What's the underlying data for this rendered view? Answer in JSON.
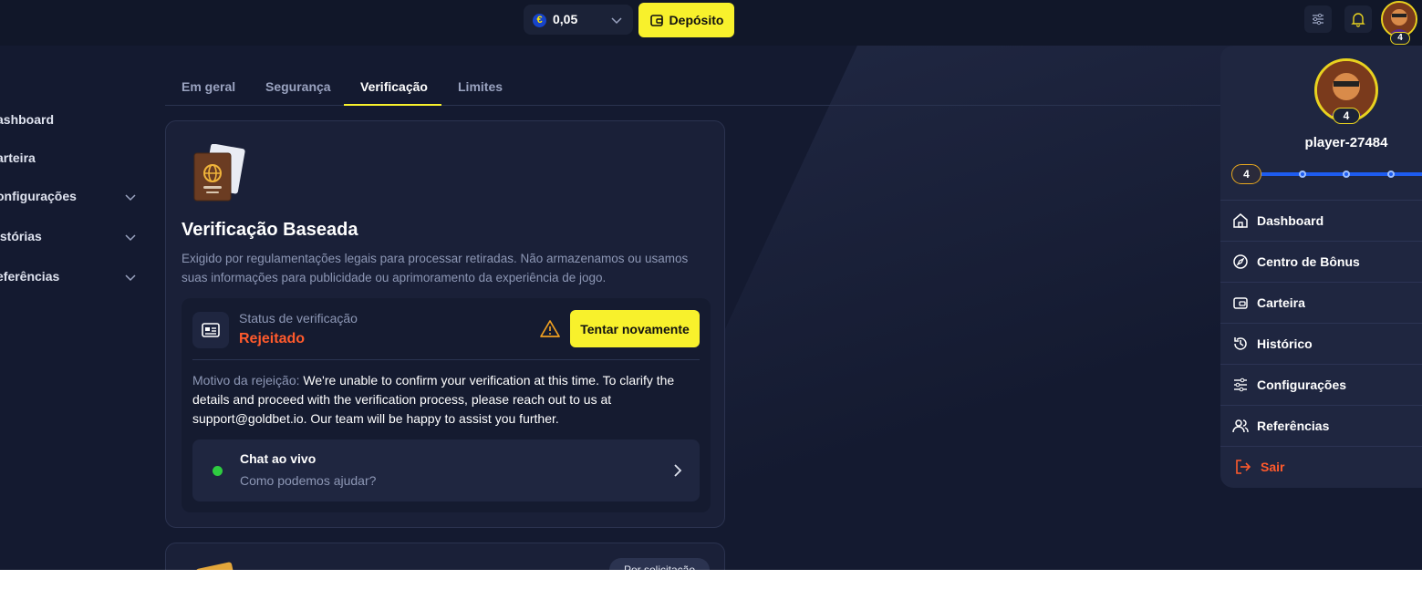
{
  "header": {
    "balance": "0,05",
    "currency_symbol": "€",
    "deposit_label": "Depósito",
    "avatar_level": "4"
  },
  "sidebar": {
    "items": [
      {
        "label": "ashboard"
      },
      {
        "label": "arteira"
      },
      {
        "label": "onfigurações"
      },
      {
        "label": "istórias"
      },
      {
        "label": "eferências"
      }
    ]
  },
  "tabs": [
    {
      "label": "Em geral"
    },
    {
      "label": "Segurança"
    },
    {
      "label": "Verificação"
    },
    {
      "label": "Limites"
    }
  ],
  "verification": {
    "title": "Verificação Baseada",
    "description": "Exigido por regulamentações legais para processar retiradas. Não armazenamos ou usamos suas informações para publicidade ou aprimoramento da experiência de jogo.",
    "status_label": "Status de verificação",
    "status_value": "Rejeitado",
    "retry_label": "Tentar novamente",
    "reason_label": "Motivo da rejeição:",
    "reason_text": "We're unable to confirm your verification at this time. To clarify the details and proceed with the verification process, please reach out to us at support@goldbet.io. Our team will be happy to assist you further.",
    "chat_title": "Chat ao vivo",
    "chat_subtitle": "Como podemos ajudar?",
    "passport_text": "PASSPORT"
  },
  "second_card": {
    "badge": "Por solicitação"
  },
  "dropdown": {
    "username": "player-27484",
    "level": "4",
    "menu": [
      {
        "label": "Dashboard",
        "icon": "home-icon"
      },
      {
        "label": "Centro de Bônus",
        "icon": "compass-icon"
      },
      {
        "label": "Carteira",
        "icon": "wallet-icon"
      },
      {
        "label": "Histórico",
        "icon": "history-icon"
      },
      {
        "label": "Configurações",
        "icon": "sliders-icon"
      },
      {
        "label": "Referências",
        "icon": "users-icon"
      },
      {
        "label": "Sair",
        "icon": "logout-icon"
      }
    ]
  },
  "colors": {
    "accent": "#f8f12c",
    "danger": "#ff5a2c",
    "background": "#141a30",
    "online": "#2ecc40"
  }
}
